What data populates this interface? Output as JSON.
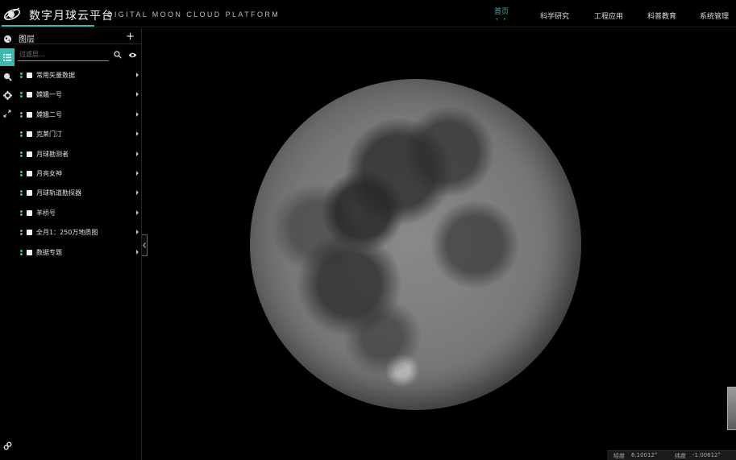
{
  "header": {
    "title": "数字月球云平台",
    "subtitle": "DIGITAL MOON CLOUD PLATFORM",
    "nav": [
      {
        "label": "首页",
        "sub": "• •",
        "active": true
      },
      {
        "label": "科学研究"
      },
      {
        "label": "工程应用"
      },
      {
        "label": "科普教育"
      },
      {
        "label": "系统管理"
      }
    ]
  },
  "rail": {
    "icons": [
      "globe-icon",
      "layers-icon",
      "search-map-icon",
      "gear-icon",
      "fullscreen-icon",
      "link-icon"
    ]
  },
  "panel": {
    "title": "图层",
    "add_label": "+",
    "search": {
      "placeholder": "过滤层...",
      "value": ""
    },
    "layers": [
      {
        "label": "常用矢量数据"
      },
      {
        "label": "嫦娥一号"
      },
      {
        "label": "嫦娥二号"
      },
      {
        "label": "克莱门汀"
      },
      {
        "label": "月球勘测者"
      },
      {
        "label": "月亮女神"
      },
      {
        "label": "月球轨道勘探器"
      },
      {
        "label": "羊桥号"
      },
      {
        "label": "全月1：250万地质图"
      },
      {
        "label": "数据专题"
      }
    ]
  },
  "status": {
    "lon_label": "经度",
    "lon_value": "6.10012°",
    "lat_label": "纬度",
    "lat_value": "-1.00612°"
  },
  "colors": {
    "accent": "#3fb7b0",
    "background": "#000000"
  }
}
